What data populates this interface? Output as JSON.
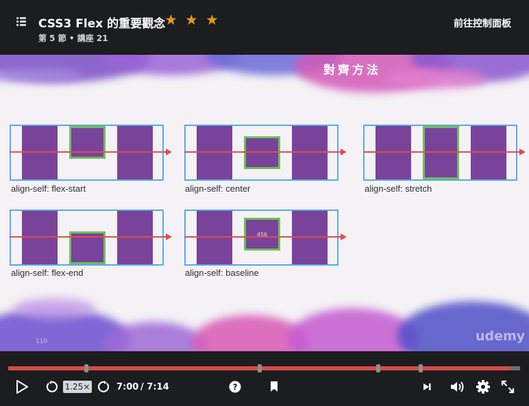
{
  "header": {
    "course_title": "CSS3 Flex 的重要觀念",
    "stars": [
      "★",
      "★",
      "★"
    ],
    "lecture_subtitle": "第 5 節 • 講座 21",
    "dashboard_link": "前往控制面板"
  },
  "slide": {
    "title": "對齊方法",
    "slide_number": "110",
    "watermark": "udemy",
    "demos": [
      {
        "label": "align-self: flex-start",
        "box_text": ""
      },
      {
        "label": "align-self: center",
        "box_text": ""
      },
      {
        "label": "align-self: stretch",
        "box_text": ""
      },
      {
        "label": "align-self: flex-end",
        "box_text": ""
      },
      {
        "label": "align-self: baseline",
        "box_text": "456"
      }
    ]
  },
  "player": {
    "progress_fraction": 0.98,
    "chapter_marker_count": 5,
    "playback_rate": "1.25×",
    "current_time": "7:00",
    "duration": "/ 7:14",
    "icons": [
      "play-icon",
      "rewind-icon",
      "forward-icon",
      "help-icon",
      "bookmark-icon",
      "next-icon",
      "volume-icon",
      "settings-icon",
      "fullscreen-icon"
    ]
  },
  "colors": {
    "background": "#1c1d1f",
    "progress_fill": "#d64b4b",
    "star": "#e59819",
    "flex_item": "#79439a",
    "highlight_border": "#6fbf5a",
    "container_border": "#5aa7ea",
    "axis": "#e04d4d"
  }
}
